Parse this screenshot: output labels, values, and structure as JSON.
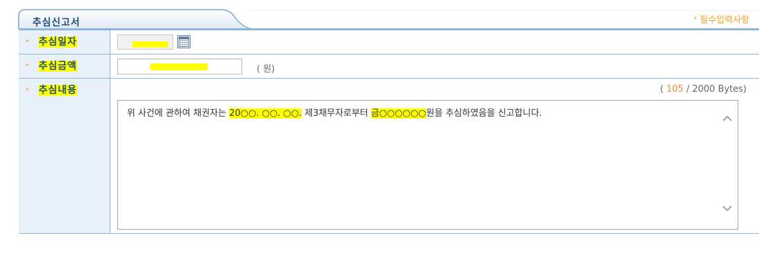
{
  "header": {
    "tab_title": "추심신고서",
    "required_star": "*",
    "required_note": "필수입력사항"
  },
  "form": {
    "date": {
      "label": "추심일자",
      "star": "*"
    },
    "amount": {
      "label": "추심금액",
      "star": "*",
      "unit": "( 원)"
    },
    "content": {
      "label": "추심내용",
      "star": "*",
      "bytes_open": "( ",
      "bytes_count": "105",
      "bytes_rest": " / 2000 Bytes)",
      "text_1": "위 사건에 관하여 채권자는 ",
      "text_date": "20○○. ○○. ○○.",
      "text_2": " 제3채무자로부터 ",
      "text_amount": "금○○○○○○",
      "text_3": "원을 추심하였음을 신고합니다."
    }
  },
  "colors": {
    "border": "#8fb4d8",
    "label_bg": "#e8f0f9",
    "highlight": "#ffff00",
    "accent": "#f0a020"
  }
}
